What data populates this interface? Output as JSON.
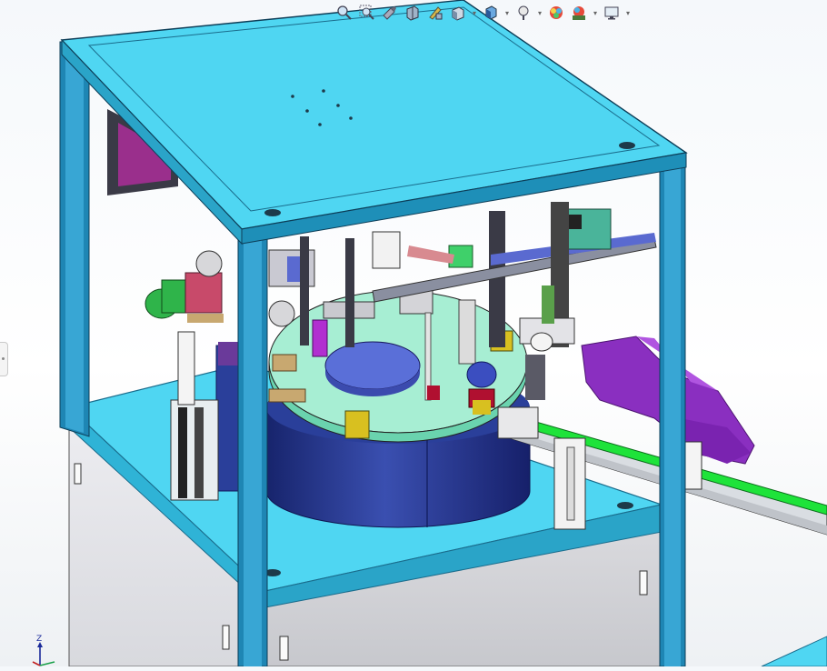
{
  "app": "SolidWorks",
  "toolbar": {
    "items": [
      {
        "name": "zoom-to-fit",
        "icon": "zoom-fit-icon"
      },
      {
        "name": "zoom-to-area",
        "icon": "zoom-area-icon"
      },
      {
        "name": "previous-view",
        "icon": "previous-view-icon"
      },
      {
        "name": "section-view",
        "icon": "section-view-icon"
      },
      {
        "name": "dynamic-annotation-views",
        "icon": "annotation-view-icon"
      },
      {
        "name": "view-orientation",
        "icon": "view-orientation-icon",
        "dropdown": true
      },
      {
        "name": "display-style",
        "icon": "display-style-icon",
        "dropdown": true
      },
      {
        "name": "hide-show-items",
        "icon": "hide-show-icon",
        "dropdown": true
      },
      {
        "name": "edit-appearance",
        "icon": "appearance-icon"
      },
      {
        "name": "apply-scene",
        "icon": "scene-icon",
        "dropdown": true
      },
      {
        "name": "view-settings",
        "icon": "monitor-icon",
        "dropdown": true
      }
    ]
  },
  "triad": {
    "axis_label": "Z"
  },
  "colors": {
    "frame": "#1e86b4",
    "plate_cyan": "#4fd6f2",
    "plate_mint": "#a7eed3",
    "drum_blue": "#2a3f9a",
    "purple": "#8a2fc0",
    "cabinet": "#e6e7ec",
    "conveyor_green": "#1ee33a"
  }
}
